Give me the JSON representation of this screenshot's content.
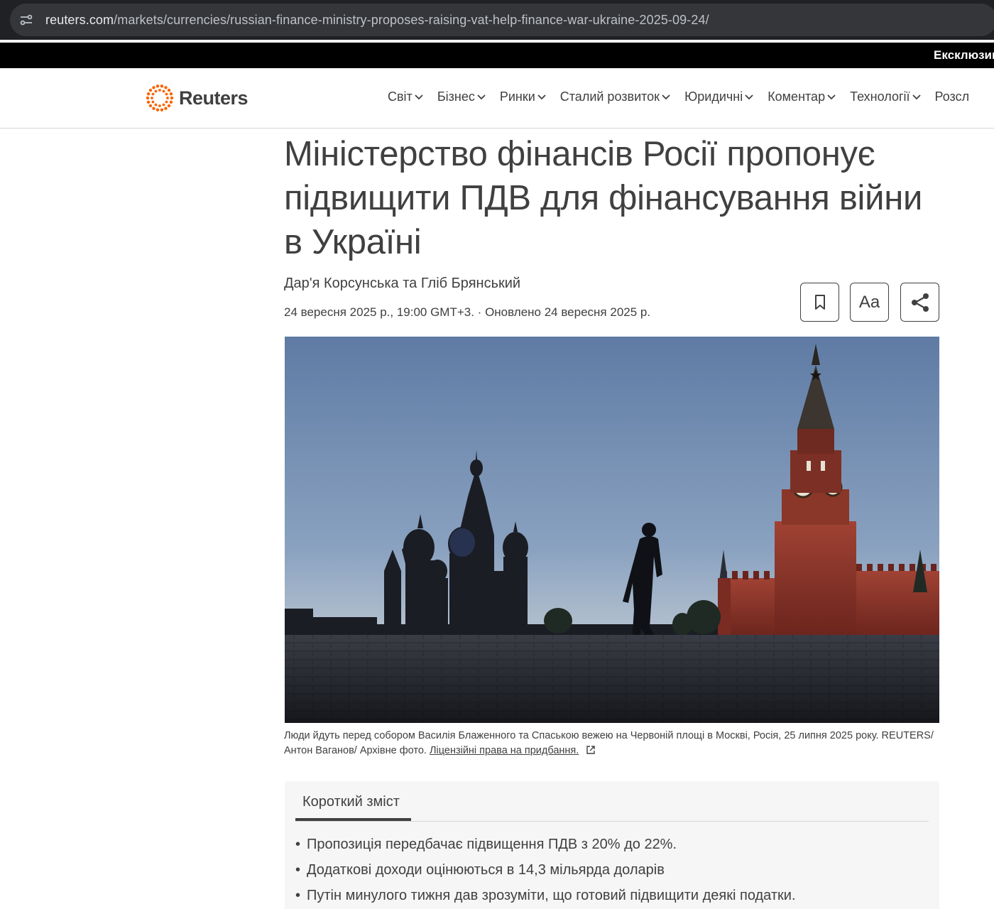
{
  "browser": {
    "url_host": "reuters.com",
    "url_path": "/markets/currencies/russian-finance-ministry-proposes-raising-vat-help-finance-war-ukraine-2025-09-24/"
  },
  "promo": {
    "text": "Ексклюзив"
  },
  "header": {
    "logo_text": "Reuters",
    "nav": [
      {
        "label": "Світ"
      },
      {
        "label": "Бізнес"
      },
      {
        "label": "Ринки"
      },
      {
        "label": "Сталий розвиток"
      },
      {
        "label": "Юридичні"
      },
      {
        "label": "Коментар"
      },
      {
        "label": "Технології"
      },
      {
        "label": "Розсл"
      }
    ]
  },
  "article": {
    "headline": "Міністерство фінансів Росії пропонує підвищити ПДВ для фінансування війни в Україні",
    "byline": "Дар'я Корсунська та Гліб Брянський",
    "dateline": "24 вересня 2025 р., 19:00 GMT+3. · Оновлено 24 вересня 2025 р.",
    "text_size_label": "Aa",
    "caption": "Люди йдуть перед собором Василія Блаженного та Спаською вежею на Червоній площі в Москві, Росія, 25 липня 2025 року. REUTERS/Антон Ваганов/ Архівне фото.",
    "caption_link": "Ліцензійні права на придбання."
  },
  "summary": {
    "tab_label": "Короткий зміст",
    "items": [
      "Пропозиція передбачає підвищення ПДВ з 20% до 22%.",
      "Додаткові доходи оцінюються в 14,3 мільярда доларів",
      "Путін минулого тижня дав зрозуміти, що готовий підвищити деякі податки."
    ]
  },
  "colors": {
    "text": "#404040",
    "accent": "#fa6400",
    "browser_bg": "#202124"
  }
}
